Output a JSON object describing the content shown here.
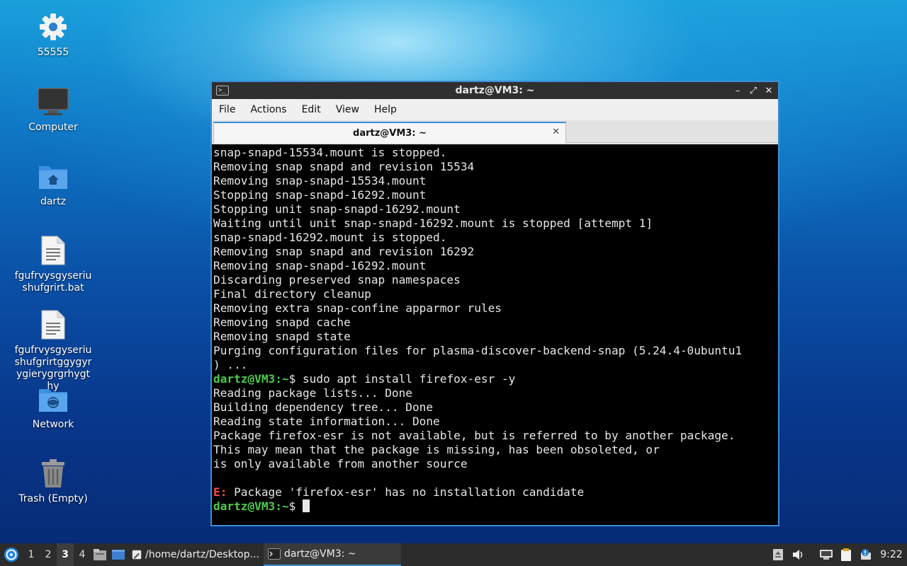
{
  "desktop": {
    "icons": [
      {
        "label": "55555",
        "icon": "gear-icon"
      },
      {
        "label": "Computer",
        "icon": "monitor-icon"
      },
      {
        "label": "dartz",
        "icon": "home-folder-icon"
      },
      {
        "label": "fgufrvysgyseriushufgrirt.bat",
        "icon": "text-file-icon"
      },
      {
        "label": "fgufrvysgyseriushufgrirtggygyrygierygrgrhygthy",
        "icon": "text-file-icon"
      },
      {
        "label": "Network",
        "icon": "network-folder-icon"
      },
      {
        "label": "Trash (Empty)",
        "icon": "trash-icon"
      }
    ]
  },
  "window": {
    "title": "dartz@VM3: ~",
    "menu": [
      "File",
      "Actions",
      "Edit",
      "View",
      "Help"
    ],
    "tab_title": "dartz@VM3: ~",
    "tab_close": "✕",
    "buttons": {
      "minimize": "–",
      "maximize": "⤢",
      "close": "✕"
    }
  },
  "terminal": {
    "prompt_user": "dartz@VM3",
    "prompt_path": ":~",
    "prompt_sign": "$ ",
    "lines_before": [
      "snap-snapd-15534.mount is stopped.",
      "Removing snap snapd and revision 15534",
      "Removing snap-snapd-15534.mount",
      "Stopping snap-snapd-16292.mount",
      "Stopping unit snap-snapd-16292.mount",
      "Waiting until unit snap-snapd-16292.mount is stopped [attempt 1]",
      "snap-snapd-16292.mount is stopped.",
      "Removing snap snapd and revision 16292",
      "Removing snap-snapd-16292.mount",
      "Discarding preserved snap namespaces",
      "Final directory cleanup",
      "Removing extra snap-confine apparmor rules",
      "Removing snapd cache",
      "Removing snapd state",
      "Purging configuration files for plasma-discover-backend-snap (5.24.4-0ubuntu1",
      ") ..."
    ],
    "command": "sudo apt install firefox-esr -y",
    "lines_after": [
      "Reading package lists... Done",
      "Building dependency tree... Done",
      "Reading state information... Done",
      "Package firefox-esr is not available, but is referred to by another package.",
      "This may mean that the package is missing, has been obsoleted, or",
      "is only available from another source",
      ""
    ],
    "error_prefix": "E:",
    "error_text": " Package 'firefox-esr' has no installation candidate"
  },
  "taskbar": {
    "workspaces": [
      "1",
      "2",
      "3",
      "4"
    ],
    "active_workspace": "3",
    "tasks": [
      {
        "label": "/home/dartz/Desktop...",
        "icon": "text-editor-icon"
      },
      {
        "label": "dartz@VM3: ~",
        "icon": "terminal-icon"
      }
    ],
    "clock": "9:22"
  },
  "colors": {
    "accent": "#3b8ed8",
    "prompt": "#4ecb4e",
    "error": "#ff4b4b"
  }
}
